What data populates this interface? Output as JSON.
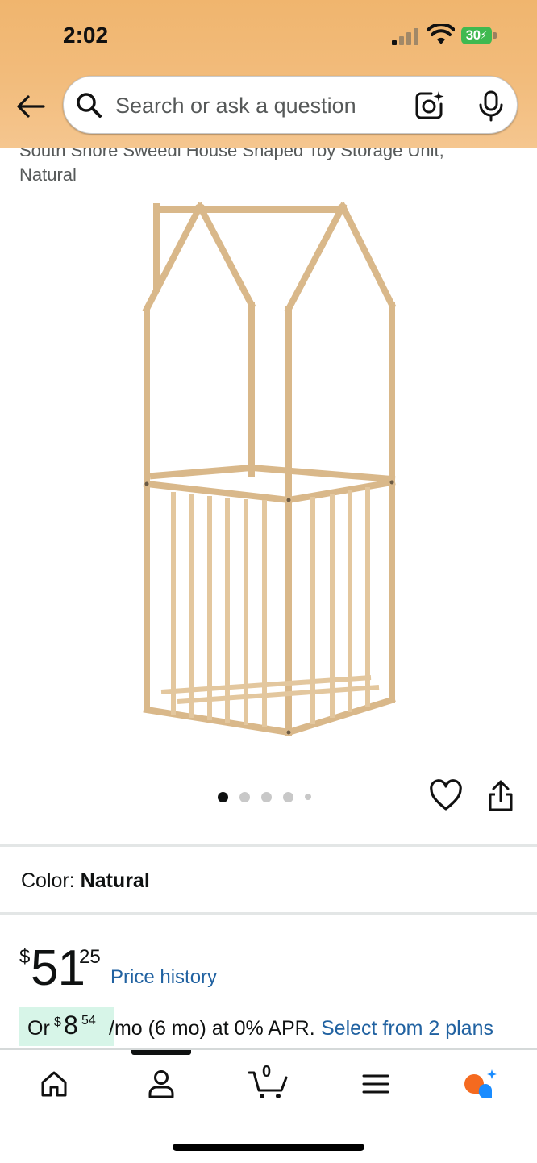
{
  "status_bar": {
    "time": "2:02",
    "battery": "30"
  },
  "search": {
    "placeholder": "Search or ask a question"
  },
  "product": {
    "title": "South Shore Sweedi House Shaped Toy Storage Unit, Natural",
    "image_count": 5,
    "active_image_index": 0
  },
  "color": {
    "label": "Color:",
    "value": "Natural"
  },
  "price": {
    "symbol": "$",
    "whole": "51",
    "fraction": "25",
    "history_link": "Price history"
  },
  "installment": {
    "prefix": "Or",
    "symbol": "$",
    "whole": "8",
    "fraction": "54",
    "text": "/mo (6 mo) at 0% APR.",
    "link": "Select from 2 plans"
  },
  "bottom_nav": {
    "items": [
      "home",
      "account",
      "cart",
      "menu",
      "rufus"
    ],
    "cart_count": "0",
    "active_index": 1
  },
  "colors": {
    "header": "#f0b56e",
    "link": "#2162a1",
    "badge_bg": "#d7f5e8"
  }
}
